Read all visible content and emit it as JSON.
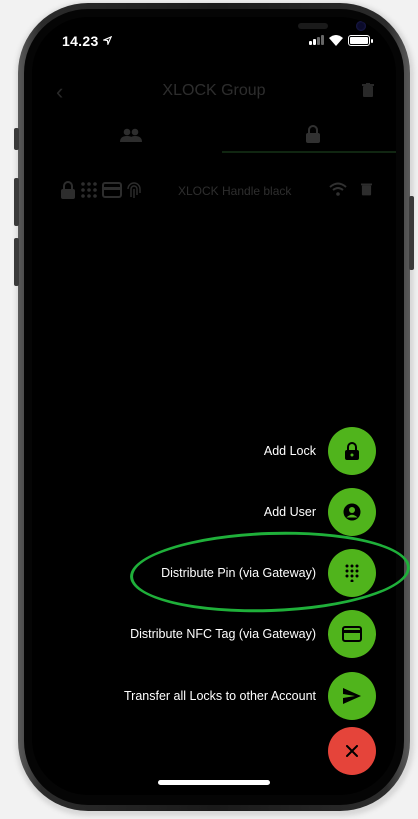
{
  "status_bar": {
    "time": "14.23"
  },
  "nav": {
    "title": "XLOCK Group"
  },
  "lock_list": [
    {
      "name": "XLOCK Handle black"
    }
  ],
  "speed_dial": {
    "items": [
      {
        "label": "Add Lock",
        "icon": "lock-icon"
      },
      {
        "label": "Add User",
        "icon": "user-icon"
      },
      {
        "label": "Distribute Pin (via Gateway)",
        "icon": "keypad-icon"
      },
      {
        "label": "Distribute NFC Tag (via Gateway)",
        "icon": "card-icon"
      },
      {
        "label": "Transfer all Locks to other Account",
        "icon": "send-icon"
      }
    ],
    "close_icon": "close-icon"
  },
  "colors": {
    "fab_green": "#50b41c",
    "fab_red": "#e5443a",
    "highlight": "#1fb03a",
    "tab_accent": "#4caf50"
  }
}
